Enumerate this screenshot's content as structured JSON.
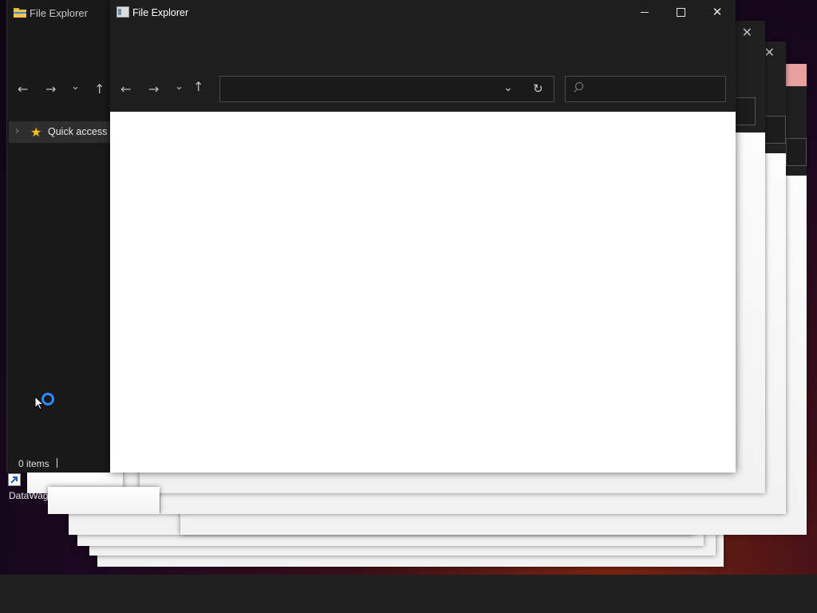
{
  "back_window": {
    "title": "File Explorer",
    "nav_pane": {
      "quick_access_label": "Quick access"
    },
    "status_bar": {
      "item_count": "0 items"
    }
  },
  "front_window": {
    "title": "File Explorer",
    "address_bar": {
      "value": "",
      "placeholder": ""
    },
    "search_box": {
      "value": "",
      "placeholder": ""
    }
  },
  "desktop": {
    "shortcut_label": "DataWag"
  },
  "icons": {
    "back": "arrow-left-icon",
    "forward": "arrow-right-icon",
    "recent": "chevron-down-icon",
    "up": "arrow-up-icon",
    "refresh": "refresh-icon",
    "search": "search-icon",
    "minimize": "minimize-icon",
    "maximize": "maximize-icon",
    "close": "close-icon",
    "star": "star-icon",
    "busy": "loading-spinner-icon"
  },
  "colors": {
    "window_chrome": "#1e1e1e",
    "content_background": "#ffffff",
    "star": "#f5c400",
    "spinner": "#2a8cff",
    "ghost_close_highlight": "#e8a0a0"
  }
}
